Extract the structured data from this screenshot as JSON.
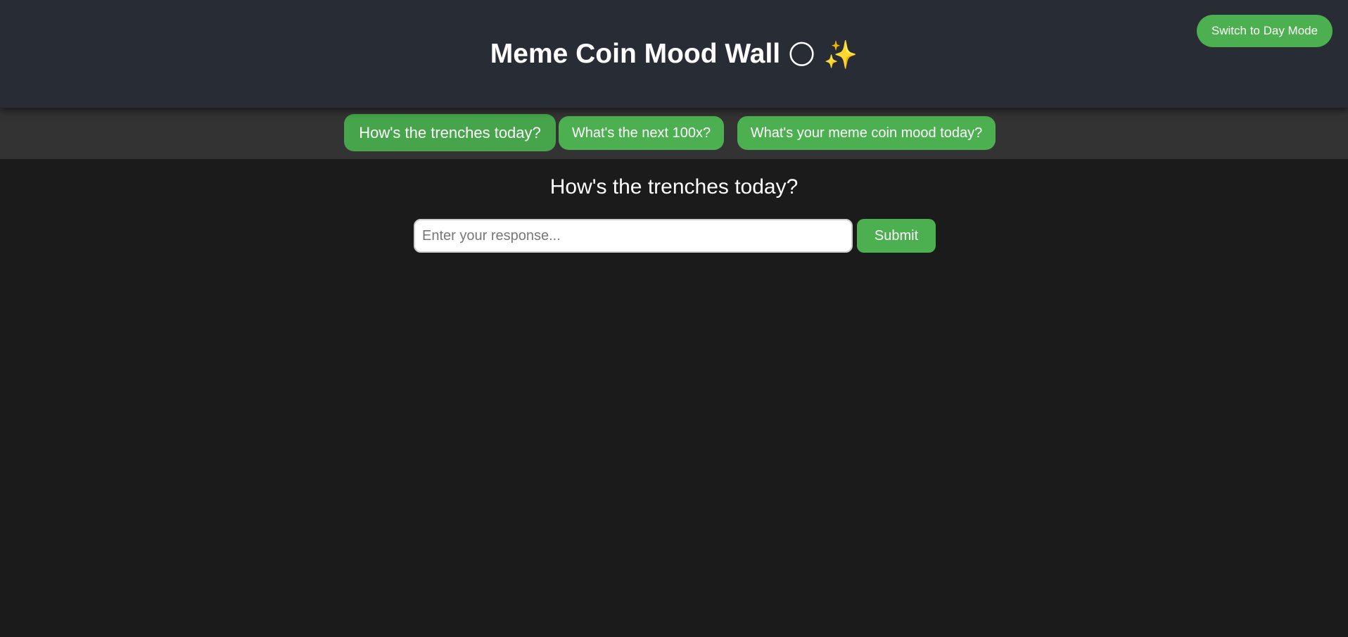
{
  "header": {
    "title": "Meme Coin Mood Wall",
    "title_emoji_moon": "🌕",
    "title_emoji_sparkles": "✨",
    "mode_toggle_label": "Switch to Day Mode"
  },
  "tabs": [
    {
      "label": "How's the trenches today?",
      "active": true
    },
    {
      "label": "What's the next 100x?",
      "active": false
    },
    {
      "label": "What's your meme coin mood today?",
      "active": false
    }
  ],
  "main": {
    "question": "How's the trenches today?",
    "input_placeholder": "Enter your response...",
    "input_value": "",
    "submit_label": "Submit"
  },
  "colors": {
    "accent": "#4caf50",
    "header_bg": "#282c35",
    "tabbar_bg": "#333333",
    "page_bg": "#1b1b1b"
  }
}
